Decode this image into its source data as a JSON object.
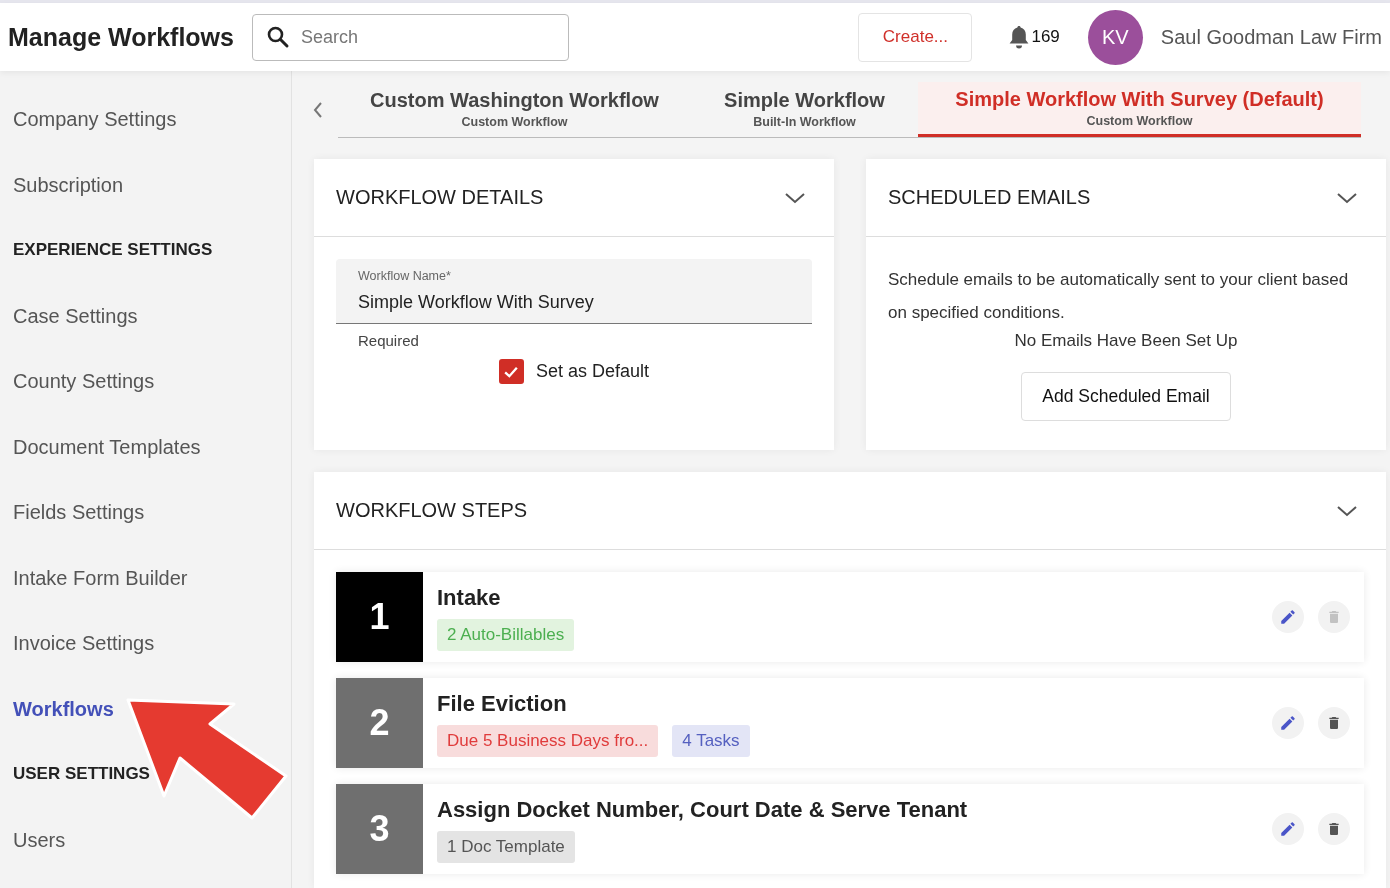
{
  "header": {
    "title": "Manage Workflows",
    "search": {
      "placeholder": "Search"
    },
    "create_button": "Create...",
    "notifications": "169",
    "avatar": "KV",
    "firm": "Saul Goodman Law Firm"
  },
  "sidebar": {
    "items": [
      {
        "kind": "link",
        "label": "Company Settings",
        "selected": false
      },
      {
        "kind": "link",
        "label": "Subscription",
        "selected": false
      },
      {
        "kind": "heading",
        "label": "EXPERIENCE SETTINGS"
      },
      {
        "kind": "link",
        "label": "Case Settings",
        "selected": false
      },
      {
        "kind": "link",
        "label": "County Settings",
        "selected": false
      },
      {
        "kind": "link",
        "label": "Document Templates",
        "selected": false
      },
      {
        "kind": "link",
        "label": "Fields Settings",
        "selected": false
      },
      {
        "kind": "link",
        "label": "Intake Form Builder",
        "selected": false
      },
      {
        "kind": "link",
        "label": "Invoice Settings",
        "selected": false
      },
      {
        "kind": "link",
        "label": "Workflows",
        "selected": true
      },
      {
        "kind": "heading",
        "label": "USER SETTINGS"
      },
      {
        "kind": "link",
        "label": "Users",
        "selected": false
      }
    ]
  },
  "tabs": [
    {
      "title": "Custom Washington Workflow",
      "subtitle": "Custom Workflow",
      "selected": false
    },
    {
      "title": "Simple Workflow",
      "subtitle": "Built-In Workflow",
      "selected": false
    },
    {
      "title": "Simple Workflow With Survey  (Default)",
      "subtitle": "Custom Workflow",
      "selected": true
    }
  ],
  "workflow_details": {
    "title": "WORKFLOW DETAILS",
    "name_field": {
      "label": "Workflow Name*",
      "value": "Simple Workflow With Survey",
      "helper": "Required"
    },
    "default_checkbox": {
      "label": "Set as Default",
      "checked": true
    }
  },
  "scheduled_emails": {
    "title": "SCHEDULED EMAILS",
    "description": "Schedule emails to be automatically sent to your client based on specified conditions.",
    "empty": "No Emails Have Been Set Up",
    "button": "Add Scheduled Email"
  },
  "workflow_steps": {
    "title": "WORKFLOW STEPS",
    "steps": [
      {
        "number": "1",
        "name": "Intake",
        "selected": true,
        "delete_disabled": true,
        "tags": [
          {
            "kind": "billable",
            "label": "2 Auto-Billables"
          }
        ]
      },
      {
        "number": "2",
        "name": "File Eviction",
        "selected": false,
        "delete_disabled": false,
        "tags": [
          {
            "kind": "due",
            "label": "Due 5 Business Days fro..."
          },
          {
            "kind": "tasks",
            "label": "4 Tasks"
          }
        ]
      },
      {
        "number": "3",
        "name": "Assign Docket Number, Court Date & Serve Tenant",
        "selected": false,
        "delete_disabled": false,
        "tags": [
          {
            "kind": "template",
            "label": "1 Doc Template"
          }
        ]
      }
    ]
  }
}
